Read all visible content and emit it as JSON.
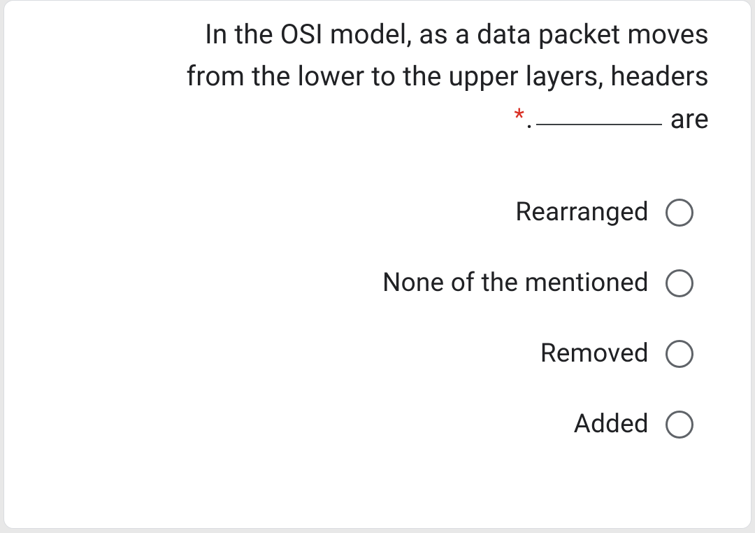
{
  "question": {
    "line1": "In the OSI model, as a data packet moves",
    "line2": "from the lower to the upper layers, headers",
    "trailing": "are"
  },
  "options": [
    {
      "label": "Rearranged"
    },
    {
      "label": "None of the mentioned"
    },
    {
      "label": "Removed"
    },
    {
      "label": "Added"
    }
  ]
}
